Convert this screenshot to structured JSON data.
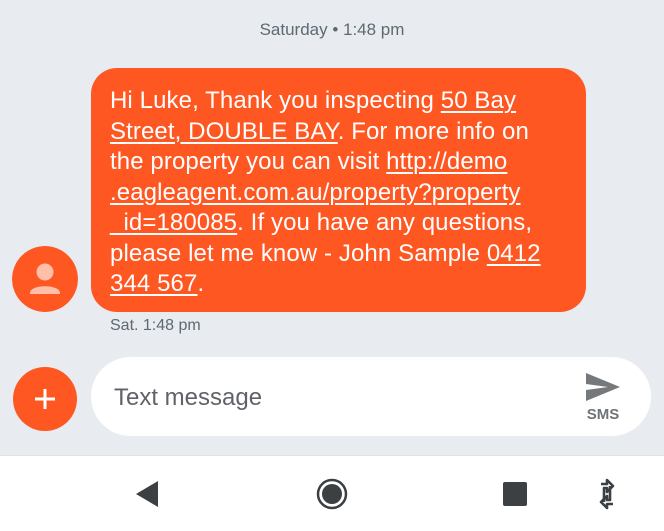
{
  "conversation": {
    "date_header": "Saturday • 1:48 pm",
    "message": {
      "lines": [
        [
          {
            "text": "Hi Luke, Thank you inspecting "
          },
          {
            "text": "50 Bay",
            "link": true
          }
        ],
        [
          {
            "text": "Street, DOUBLE BAY",
            "link": true
          },
          {
            "text": ". For more info on"
          }
        ],
        [
          {
            "text": "the property you can visit "
          },
          {
            "text": "http://demo",
            "link": true
          }
        ],
        [
          {
            "text": ".eagleagent.com.au/property?property",
            "link": true
          }
        ],
        [
          {
            "text": "_id=180085",
            "link": true
          },
          {
            "text": ". If you have any questions,"
          }
        ],
        [
          {
            "text": "please let me know - John Sample "
          },
          {
            "text": "0412",
            "link": true
          }
        ],
        [
          {
            "text": "344 567",
            "link": true
          },
          {
            "text": "."
          }
        ]
      ],
      "timestamp": "Sat. 1:48 pm"
    }
  },
  "compose": {
    "placeholder": "Text message",
    "send_label": "SMS"
  },
  "icons": {
    "avatar": "person-icon",
    "add": "plus-icon",
    "send": "send-icon",
    "nav_back": "back-triangle-icon",
    "nav_home": "home-circle-icon",
    "nav_recents": "recents-square-icon",
    "nav_rotate": "rotate-icon"
  },
  "colors": {
    "bubble": "#ff5722",
    "avatar_bg": "#ff5722",
    "fab": "#ff5722",
    "chat_background": "#e8ebef",
    "nav_icons": "#3c4043"
  }
}
